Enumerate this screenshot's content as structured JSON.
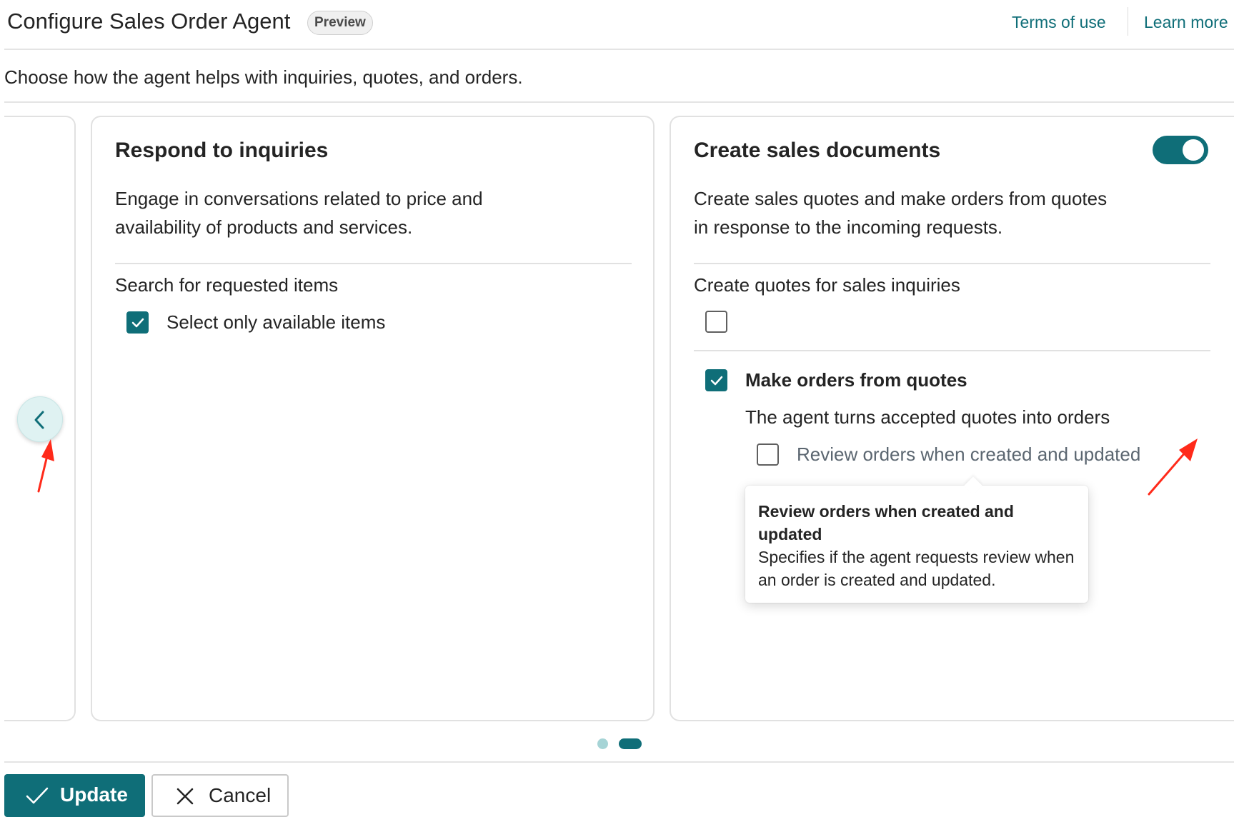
{
  "header": {
    "title": "Configure Sales Order Agent",
    "badge": "Preview",
    "terms_link": "Terms of use",
    "learn_link": "Learn more"
  },
  "subtitle": "Choose how the agent helps with inquiries, quotes, and orders.",
  "cards": {
    "inquiries": {
      "title": "Respond to inquiries",
      "description": "Engage in conversations related to price and availability of products and services.",
      "section_label": "Search for requested items",
      "option_label": "Select only available items",
      "option_checked": true
    },
    "sales_docs": {
      "title": "Create sales documents",
      "toggle_on": true,
      "description": "Create sales quotes and make orders from quotes in response to the incoming requests.",
      "quotes_label": "Create quotes for sales inquiries",
      "quotes_checked": false,
      "orders_label": "Make orders from quotes",
      "orders_checked": true,
      "orders_description": "The agent turns accepted quotes into orders",
      "review_label": "Review orders when created and updated",
      "review_checked": false
    }
  },
  "tooltip": {
    "title": "Review orders when created and updated",
    "text": "Specifies if the agent requests review when an order is created and updated."
  },
  "pagination": {
    "page_count": 2,
    "active_page": 2
  },
  "footer": {
    "update_label": "Update",
    "cancel_label": "Cancel"
  },
  "colors": {
    "accent": "#0f6e78",
    "annotation": "#ff2a1a"
  },
  "icons": {
    "nav": "chevron-left-icon",
    "update": "checkmark-icon",
    "cancel": "close-icon"
  }
}
